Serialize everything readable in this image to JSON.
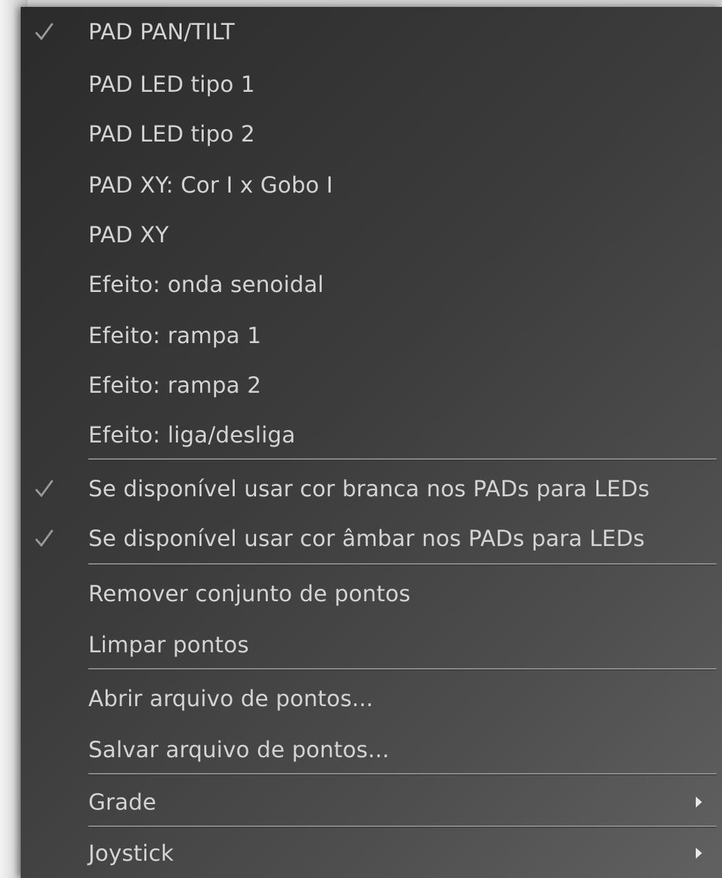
{
  "menu": {
    "items": [
      {
        "label": "PAD PAN/TILT",
        "checked": true
      },
      {
        "label": "PAD LED tipo 1",
        "checked": false
      },
      {
        "label": "PAD LED tipo 2",
        "checked": false
      },
      {
        "label": "PAD XY: Cor I x Gobo I",
        "checked": false
      },
      {
        "label": "PAD XY",
        "checked": false
      },
      {
        "label": "Efeito: onda senoidal",
        "checked": false
      },
      {
        "label": "Efeito: rampa 1",
        "checked": false
      },
      {
        "label": "Efeito: rampa 2",
        "checked": false
      },
      {
        "label": "Efeito: liga/desliga",
        "checked": false
      },
      {
        "label": "Se disponível usar cor branca nos PADs para LEDs",
        "checked": true
      },
      {
        "label": "Se disponível usar cor âmbar nos PADs para LEDs",
        "checked": true
      },
      {
        "label": "Remover conjunto de pontos",
        "checked": false
      },
      {
        "label": "Limpar pontos",
        "checked": false
      },
      {
        "label": "Abrir arquivo de pontos...",
        "checked": false
      },
      {
        "label": "Salvar arquivo de pontos...",
        "checked": false
      },
      {
        "label": "Grade",
        "checked": false,
        "submenu": true
      },
      {
        "label": "Joystick",
        "checked": false,
        "submenu": true
      }
    ]
  },
  "icons": {
    "check": "checkmark-icon",
    "submenu": "submenu-arrow-icon"
  },
  "colors": {
    "menu_background": "#3c3c3c",
    "text": "#d3d3d3",
    "check": "#9a9a9a",
    "separator": "#8d8d8d"
  }
}
